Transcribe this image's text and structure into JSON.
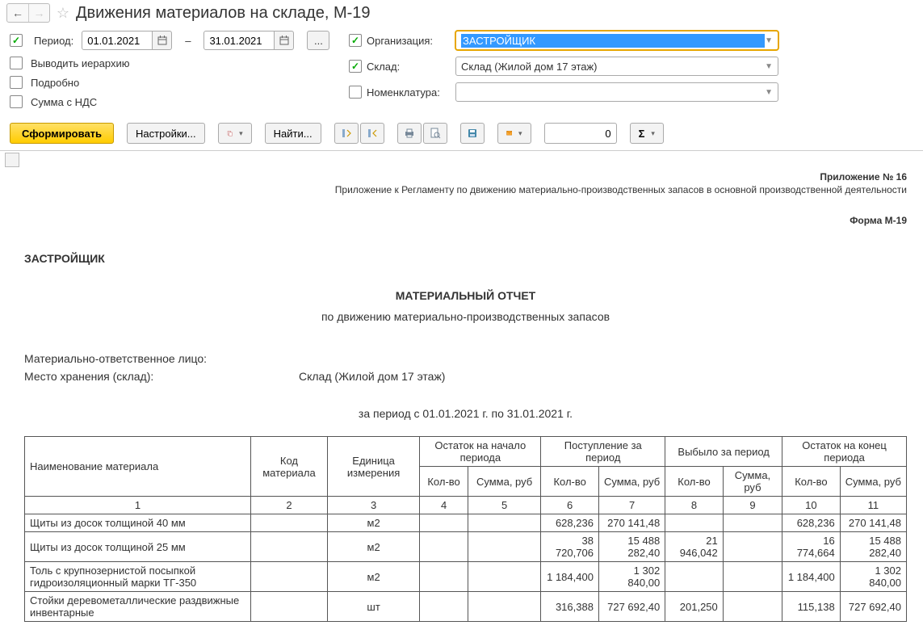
{
  "titlebar": {
    "title": "Движения материалов на складе, М-19"
  },
  "filters": {
    "period_label": "Период:",
    "date_from": "01.01.2021",
    "date_to": "31.01.2021",
    "hierarchy_label": "Выводить иерархию",
    "detail_label": "Подробно",
    "vat_label": "Сумма с НДС",
    "org_label": "Организация:",
    "org_value": "ЗАСТРОЙЩИК",
    "warehouse_label": "Склад:",
    "warehouse_value": "Склад (Жилой дом 17 этаж)",
    "nomen_label": "Номенклатура:",
    "nomen_value": ""
  },
  "toolbar": {
    "generate": "Сформировать",
    "settings": "Настройки...",
    "find": "Найти...",
    "sum_value": "0"
  },
  "report": {
    "attachment": "Приложение № 16",
    "reg_text": "Приложение к Регламенту по движению материально-производственных запасов в основной производственной деятельности",
    "form_no": "Форма М-19",
    "org": "ЗАСТРОЙЩИК",
    "title": "МАТЕРИАЛЬНЫЙ ОТЧЕТ",
    "subtitle": "по движению материально-производственных запасов",
    "resp_label": "Материально-ответственное лицо:",
    "resp_value": "",
    "storage_label": "Место хранения (склад):",
    "storage_value": "Склад (Жилой дом 17 этаж)",
    "period_line": "за период с 01.01.2021 г. по 31.01.2021 г."
  },
  "table": {
    "headers": {
      "name": "Наименование материала",
      "code": "Код материала",
      "unit": "Единица измерения",
      "start": "Остаток на начало периода",
      "in": "Поступление за период",
      "out": "Выбыло за период",
      "end": "Остаток на конец периода",
      "qty": "Кол-во",
      "sum": "Сумма, руб"
    },
    "col_numbers": [
      "1",
      "2",
      "3",
      "4",
      "5",
      "6",
      "7",
      "8",
      "9",
      "10",
      "11"
    ],
    "rows": [
      {
        "name": "Щиты из досок  толщиной 40 мм",
        "code": "",
        "unit": "м2",
        "sq": "",
        "ss": "",
        "iq": "628,236",
        "is": "270 141,48",
        "oq": "",
        "os": "",
        "eq": "628,236",
        "es": "270 141,48"
      },
      {
        "name": "Щиты из досок  толщиной 25 мм",
        "code": "",
        "unit": "м2",
        "sq": "",
        "ss": "",
        "iq": "38 720,706",
        "is": "15 488 282,40",
        "oq": "21 946,042",
        "os": "",
        "eq": "16 774,664",
        "es": "15 488 282,40"
      },
      {
        "name": "Толь с крупнозернистой посыпкой гидроизоляционный марки ТГ-350",
        "code": "",
        "unit": "м2",
        "sq": "",
        "ss": "",
        "iq": "1 184,400",
        "is": "1 302 840,00",
        "oq": "",
        "os": "",
        "eq": "1 184,400",
        "es": "1 302 840,00"
      },
      {
        "name": "Стойки деревометаллические раздвижные инвентарные",
        "code": "",
        "unit": "шт",
        "sq": "",
        "ss": "",
        "iq": "316,388",
        "is": "727 692,40",
        "oq": "201,250",
        "os": "",
        "eq": "115,138",
        "es": "727 692,40"
      }
    ]
  }
}
